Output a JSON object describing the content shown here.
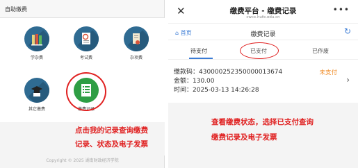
{
  "left": {
    "header": "自助缴费",
    "items": [
      {
        "label": "学杂费",
        "icon": "books-icon"
      },
      {
        "label": "考试费",
        "icon": "exam-icon"
      },
      {
        "label": "杂项费",
        "icon": "scroll-icon"
      },
      {
        "label": "其它缴费",
        "icon": "graduation-cap-icon"
      },
      {
        "label": "缴费记录",
        "icon": "records-icon"
      }
    ],
    "note_line1": "点击我的记录查询缴费",
    "note_line2": "记录、状态及电子发票",
    "copyright": "Copyright © 2025  湖南财政经济学院"
  },
  "right": {
    "title": "缴费平台 - 缴费记录",
    "subtitle": "cwcx.hufe.edu.cn",
    "home": "首页",
    "nav_title": "缴费记录",
    "tabs": [
      "待支付",
      "已支付",
      "已作废"
    ],
    "record": {
      "code": "缴款码：430000252350000013674",
      "amount": "金额：130.00",
      "time": "时间：2025-03-13 14:26:28",
      "status": "未支付"
    },
    "note_line1": "查看缴费状态，选择已支付查询",
    "note_line2": "缴费记录及电子发票"
  },
  "colors": {
    "accent": "#3a7bd5",
    "highlight": "#e02020",
    "status": "#f08a24",
    "icon_bg": "#2f6b92"
  }
}
